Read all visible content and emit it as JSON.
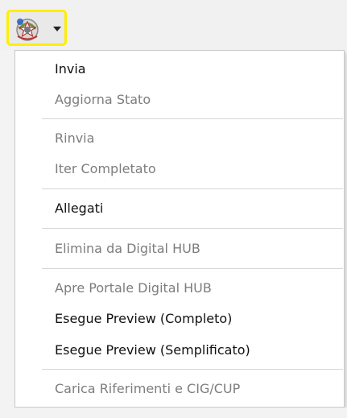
{
  "toolbar": {
    "dropdown_icon": "italian-emblem-icon",
    "caret_icon": "chevron-down-icon",
    "highlight_color": "#ffee00"
  },
  "menu": {
    "items": [
      {
        "label": "Invia",
        "enabled": true
      },
      {
        "label": "Aggiorna Stato",
        "enabled": false
      },
      {
        "label": "Rinvia",
        "enabled": false
      },
      {
        "label": "Iter Completato",
        "enabled": false
      },
      {
        "label": "Allegati",
        "enabled": true
      },
      {
        "label": "Elimina da Digital HUB",
        "enabled": false
      },
      {
        "label": "Apre Portale Digital HUB",
        "enabled": false
      },
      {
        "label": "Esegue Preview (Completo)",
        "enabled": true
      },
      {
        "label": "Esegue Preview (Semplificato)",
        "enabled": true
      },
      {
        "label": "Carica Riferimenti e CIG/CUP",
        "enabled": false
      }
    ]
  }
}
